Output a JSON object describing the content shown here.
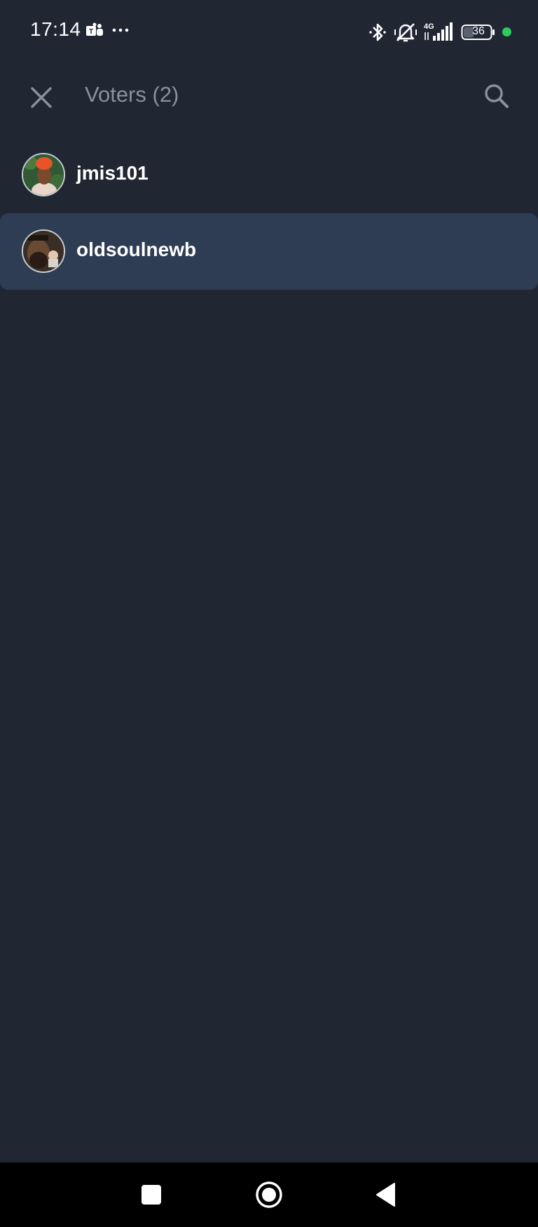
{
  "status_bar": {
    "time": "17:14",
    "network": "4G",
    "battery": "36",
    "icons": [
      "teams-icon",
      "more-dots-icon",
      "bluetooth-icon",
      "vibrate-mute-icon",
      "signal-icon",
      "battery-icon"
    ]
  },
  "header": {
    "title": "Voters (2)",
    "close_icon": "close-icon",
    "search_icon": "search-icon"
  },
  "voters": [
    {
      "username": "jmis101",
      "selected": false
    },
    {
      "username": "oldsoulnewb",
      "selected": true
    }
  ],
  "colors": {
    "background": "#202733",
    "selected_row": "#2f3d54",
    "title_text": "#8a919b",
    "status_dot": "#2ecc5f"
  },
  "nav_bar": {
    "icons": [
      "recents-icon",
      "home-icon",
      "back-icon"
    ]
  }
}
